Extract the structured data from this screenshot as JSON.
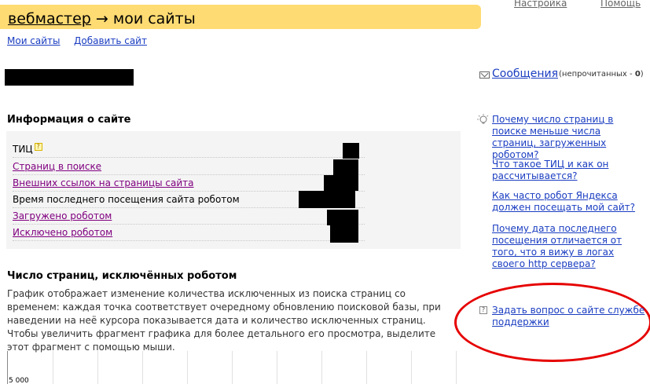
{
  "header": {
    "crumb": "вебмастер",
    "arrow": "→",
    "title": "мои сайты"
  },
  "top_nav": {
    "settings": "Настройка",
    "help": "Помощь"
  },
  "subnav": {
    "my_sites": "Мои сайты",
    "add_site": "Добавить сайт"
  },
  "info": {
    "heading": "Информация о сайте",
    "rows": [
      {
        "label": "ТИЦ"
      },
      {
        "label": "Страниц в поиске"
      },
      {
        "label": "Внешних ссылок на страницы сайта"
      },
      {
        "label": "Время последнего посещения сайта роботом"
      },
      {
        "label": "Загружено роботом"
      },
      {
        "label": "Исключено роботом"
      }
    ],
    "tic_help_icon": "question-icon"
  },
  "chart_section": {
    "heading": "Число страниц, исключённых роботом",
    "description": "График отображает изменение количества исключенных из поиска страниц со временем: каждая точка соответствует очередному обновлению поисковой базы, при наведении на неё курсора показывается дата и количество исключенных страниц. Чтобы увеличить фрагмент графика для более детального его просмотра, выделите этот фрагмент с помощью мыши.",
    "y_tick": "5 000"
  },
  "sidebar": {
    "messages_label": "Сообщения",
    "unread_prefix": "(непрочитанных - ",
    "unread_count": "0",
    "unread_suffix": ")",
    "faq": [
      "Почему число страниц в поиске меньше числа страниц, загруженных роботом?",
      "Что такое ТИЦ и как он рассчитывается?",
      "Как часто робот Яндекса должен посещать мой сайт?",
      "Почему дата последнего посещения отличается от того, что я вижу в логах своего http сервера?"
    ],
    "ask_support": "Задать вопрос о сайте службе поддержки"
  },
  "colors": {
    "header_bg": "#ffdb73",
    "link": "#1a3dc1",
    "visited_link": "#800080",
    "highlight_ellipse": "#e60000",
    "info_box_bg": "#f4f4f4"
  },
  "icons": {
    "messages": "envelope-icon",
    "tips": "lightbulb-icon",
    "ask": "question-icon"
  }
}
